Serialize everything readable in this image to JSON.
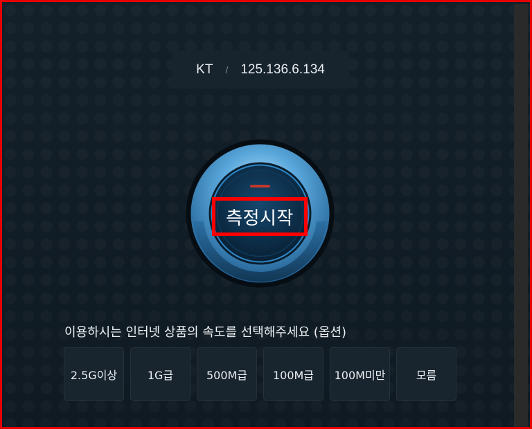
{
  "connection": {
    "isp": "KT",
    "separator": "/",
    "ip": "125.136.6.134"
  },
  "start_button": {
    "label": "측정시작"
  },
  "speed_prompt": "이용하시는 인터넷 상품의 속도를 선택해주세요 (옵션)",
  "speed_options": [
    "2.5G이상",
    "1G급",
    "500M급",
    "100M급",
    "100M미만",
    "모름"
  ],
  "colors": {
    "highlight": "#ff0000",
    "background": "#101a22",
    "gauge_ring": "#5aa8dc",
    "indicator": "#c0392b"
  }
}
